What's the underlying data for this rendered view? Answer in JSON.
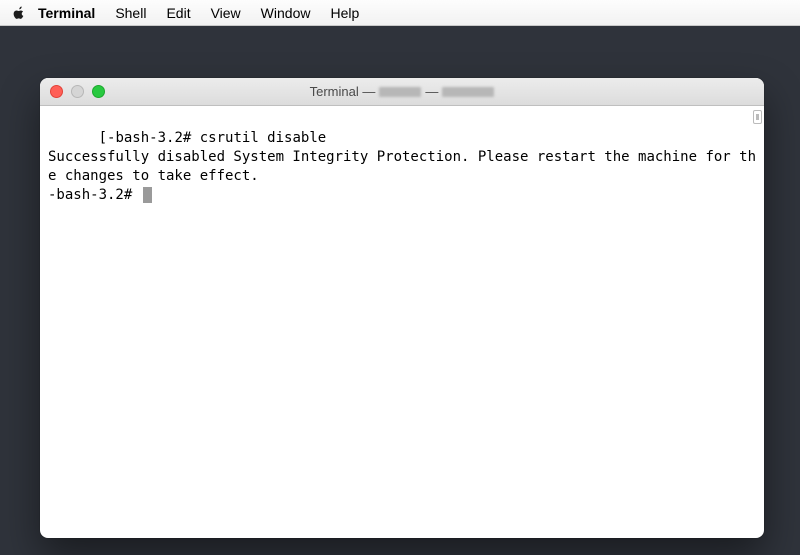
{
  "menubar": {
    "app_name": "Terminal",
    "items": [
      "Shell",
      "Edit",
      "View",
      "Window",
      "Help"
    ]
  },
  "window": {
    "title_prefix": "Terminal —"
  },
  "terminal": {
    "line1_prompt_bracket": "[",
    "line1_prompt": "-bash-3.2#",
    "line1_command": "csrutil disable",
    "line2": "Successfully disabled System Integrity Protection. Please restart the machine for the changes to take effect.",
    "line3_prompt": "-bash-3.2#"
  }
}
